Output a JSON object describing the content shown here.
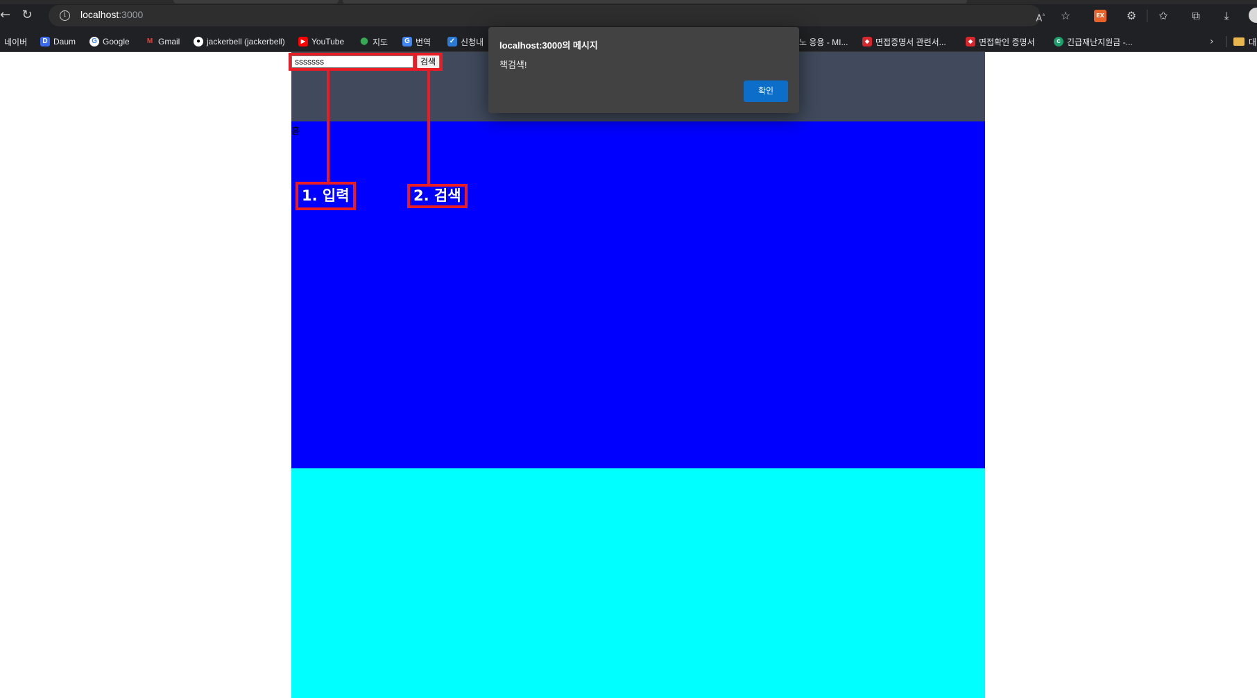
{
  "browser": {
    "url_host": "localhost",
    "url_port": ":3000",
    "bookmarks": [
      {
        "label": "네이버"
      },
      {
        "label": "Daum"
      },
      {
        "label": "Google"
      },
      {
        "label": "Gmail"
      },
      {
        "label": "jackerbell (jackerbell)"
      },
      {
        "label": "YouTube"
      },
      {
        "label": "지도"
      },
      {
        "label": "번역"
      },
      {
        "label": "신청내"
      },
      {
        "label": "노 응용 - MI..."
      },
      {
        "label": "면접증명서 관련서..."
      },
      {
        "label": "면접확인 증명서"
      },
      {
        "label": "긴급재난지원금 -..."
      },
      {
        "label": "대"
      }
    ]
  },
  "page": {
    "search_value": "sssssss",
    "search_button_label": "검색",
    "home_text": "홈",
    "colors": {
      "header": "#404a5c",
      "main": "#0000ff",
      "footer": "#00ffff"
    }
  },
  "annotations": {
    "input_label": "1. 입력",
    "search_label": "2. 검색",
    "color": "#ea1c24"
  },
  "dialog": {
    "title": "localhost:3000의 메시지",
    "message": "책검색!",
    "ok_label": "확인"
  }
}
